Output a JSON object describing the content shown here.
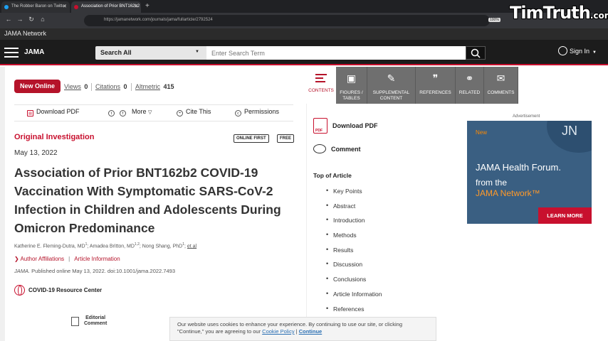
{
  "browser": {
    "tabs": [
      {
        "title": "The Robber Baron on Twitter",
        "favicon_color": "#1da1f2"
      },
      {
        "title": "Association of Prior BNT162b2",
        "favicon_color": "#c8102e"
      }
    ],
    "new_tab": "+",
    "url": "https://jamanetwork.com/journals/jama/fullarticle/2792524",
    "zoom": "100%",
    "watermark": "TimTruth",
    "watermark_suffix": ".com",
    "bookmark_label": "JAMA Network"
  },
  "header": {
    "logo": "JAMA",
    "search_scope": "Search All",
    "search_placeholder": "Enter Search Term",
    "signin": "Sign In"
  },
  "article_meta": {
    "new_online": "New Online",
    "views_label": "Views",
    "views": "0",
    "citations_label": "Citations",
    "citations": "0",
    "altmetric_label": "Altmetric",
    "altmetric": "415"
  },
  "actions": {
    "download_pdf": "Download PDF",
    "twitter_icon": "t",
    "facebook_icon": "f",
    "more": "More",
    "cite_this": "Cite This",
    "permissions": "Permissions"
  },
  "article": {
    "type": "Original Investigation",
    "badge_online_first": "ONLINE FIRST",
    "badge_free": "FREE",
    "date": "May 13, 2022",
    "title": "Association of Prior BNT162b2 COVID-19 Vaccination With Symptomatic SARS-CoV-2 Infection in Children and Adolescents During Omicron Predominance",
    "authors": [
      {
        "name": "Katherine E. Fleming-Dutra, MD",
        "sup": "1"
      },
      {
        "name": "Amadea Britton, MD",
        "sup": "1,2"
      },
      {
        "name": "Nong Shang, PhD",
        "sup": "1"
      }
    ],
    "et_al": "et al",
    "author_affiliations": "Author Affiliations",
    "article_information": "Article Information",
    "citation_journal": "JAMA.",
    "citation_rest": " Published online May 13, 2022. doi:10.1001/jama.2022.7493",
    "covid_center": "COVID-19 Resource Center",
    "editorial_line1": "Editorial",
    "editorial_line2": "Comment"
  },
  "toc_toolbar": [
    {
      "label1": "CONTENTS",
      "label2": ""
    },
    {
      "label1": "FIGURES /",
      "label2": "TABLES"
    },
    {
      "label1": "SUPPLEMENTAL",
      "label2": "CONTENT"
    },
    {
      "label1": "REFERENCES",
      "label2": ""
    },
    {
      "label1": "RELATED",
      "label2": ""
    },
    {
      "label1": "COMMENTS",
      "label2": ""
    }
  ],
  "right": {
    "download_pdf": "Download PDF",
    "comment": "Comment",
    "top_of_article": "Top of Article",
    "toc_items": [
      "Key Points",
      "Abstract",
      "Introduction",
      "Methods",
      "Results",
      "Discussion",
      "Conclusions",
      "Article Information",
      "References"
    ]
  },
  "ad": {
    "label": "Advertisement",
    "new": "New",
    "jn": "JN",
    "title": "JAMA Health Forum.",
    "from": "from the",
    "network": "JAMA Network™",
    "cta": "LEARN MORE"
  },
  "cookie": {
    "text1": "Our website uses cookies to enhance your experience. By continuing to use our site, or clicking",
    "text2": "\"Continue,\" you are agreeing to our ",
    "policy": "Cookie Policy",
    "sep": " | ",
    "continue": "Continue"
  }
}
